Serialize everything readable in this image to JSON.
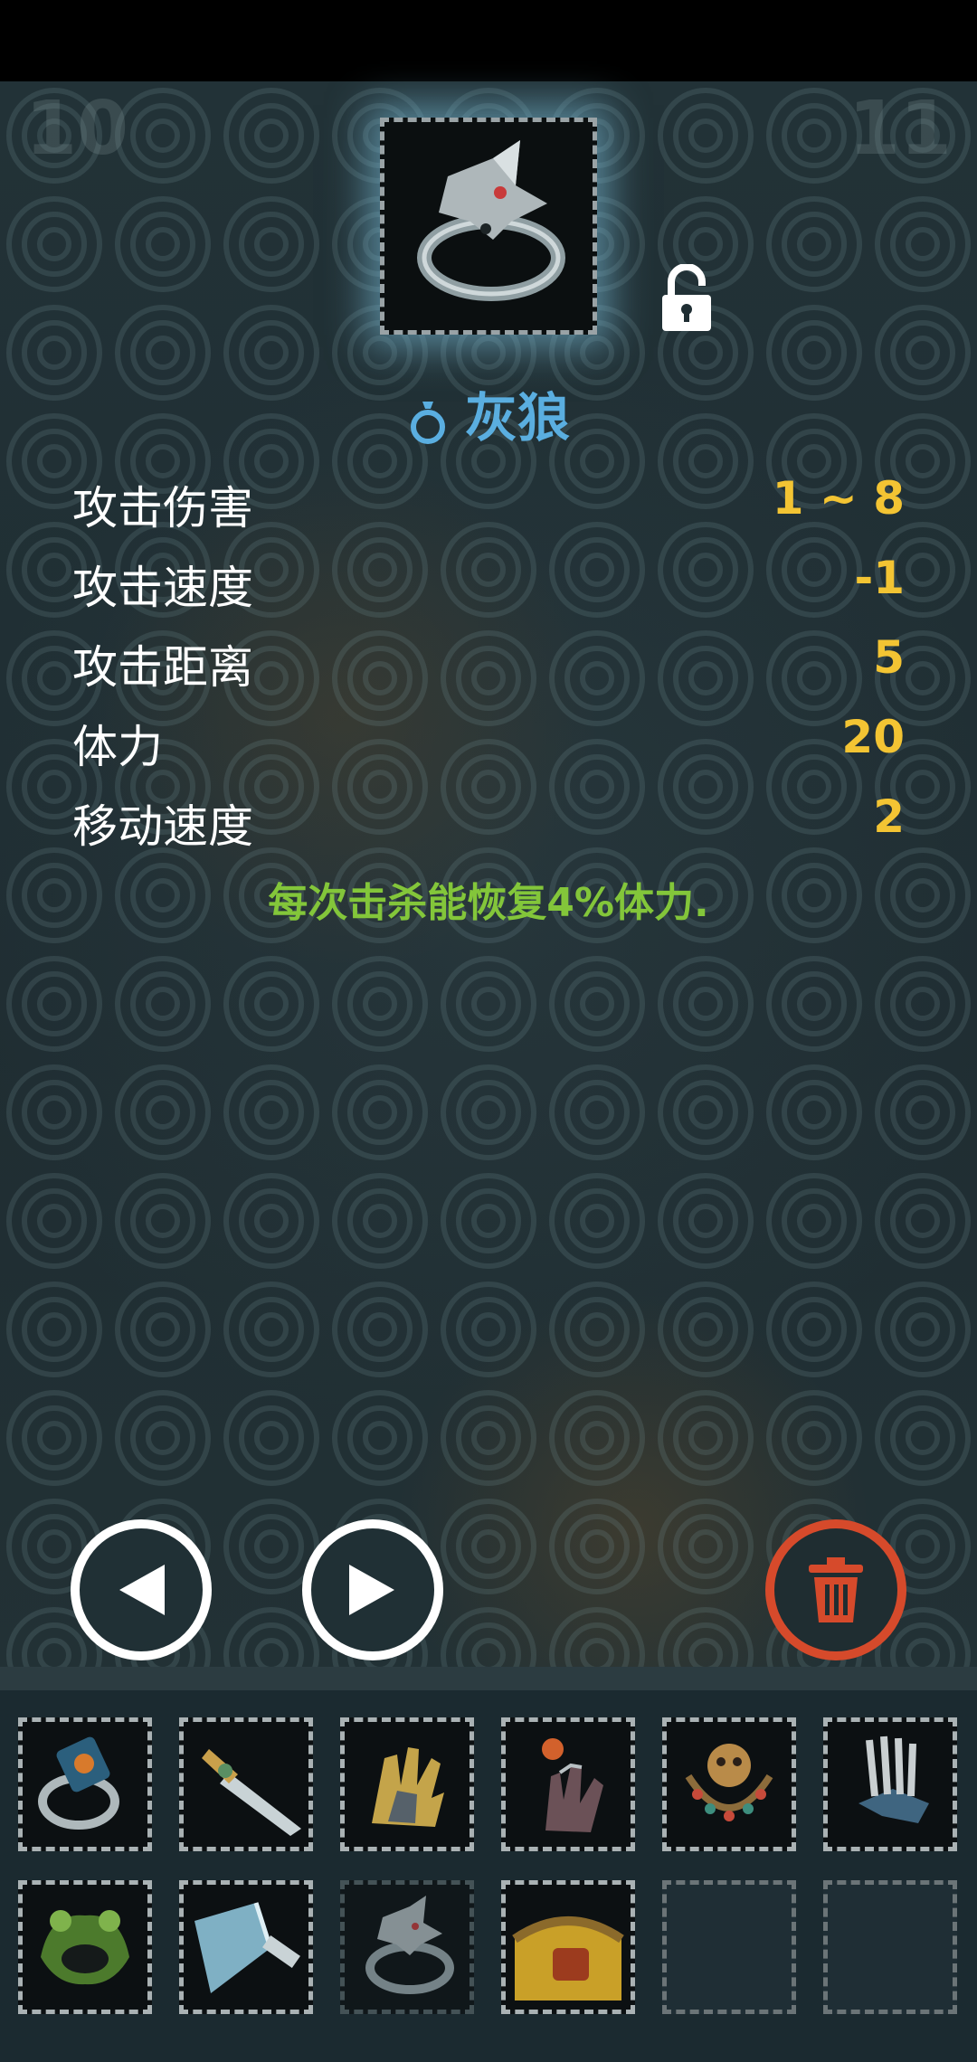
{
  "corner_left": "10",
  "corner_right": "11",
  "item": {
    "name": "灰狼",
    "icon": "gray-wolf-ring-icon",
    "type_icon": "ring-type-icon",
    "locked": false
  },
  "stats": [
    {
      "label": "攻击伤害",
      "value": "1 ~ 8"
    },
    {
      "label": "攻击速度",
      "value": "-1"
    },
    {
      "label": "攻击距离",
      "value": "5"
    },
    {
      "label": "体力",
      "value": "20"
    },
    {
      "label": "移动速度",
      "value": "2"
    }
  ],
  "effect": "每次击杀能恢复4%体力.",
  "buttons": {
    "prev": "left-arrow-icon",
    "next": "right-arrow-icon",
    "discard": "trash-icon"
  },
  "inventory": [
    {
      "item": "ring-orange-gem-icon",
      "selected": false
    },
    {
      "item": "dagger-icon",
      "selected": false
    },
    {
      "item": "gold-gauntlet-icon",
      "selected": false
    },
    {
      "item": "dark-claw-glove-icon",
      "selected": false
    },
    {
      "item": "bead-necklace-icon",
      "selected": false
    },
    {
      "item": "claw-glove-icon",
      "selected": false
    },
    {
      "item": "frog-amulet-icon",
      "selected": false
    },
    {
      "item": "ice-blade-icon",
      "selected": false
    },
    {
      "item": "gray-wolf-ring-icon",
      "selected": true
    },
    {
      "item": "gold-belt-icon",
      "selected": false
    },
    {
      "item": "empty",
      "selected": false
    },
    {
      "item": "empty",
      "selected": false
    }
  ],
  "colors": {
    "title": "#5aaee0",
    "stat_value": "#f3c433",
    "effect": "#83c63a",
    "trash": "#d64a2b"
  }
}
